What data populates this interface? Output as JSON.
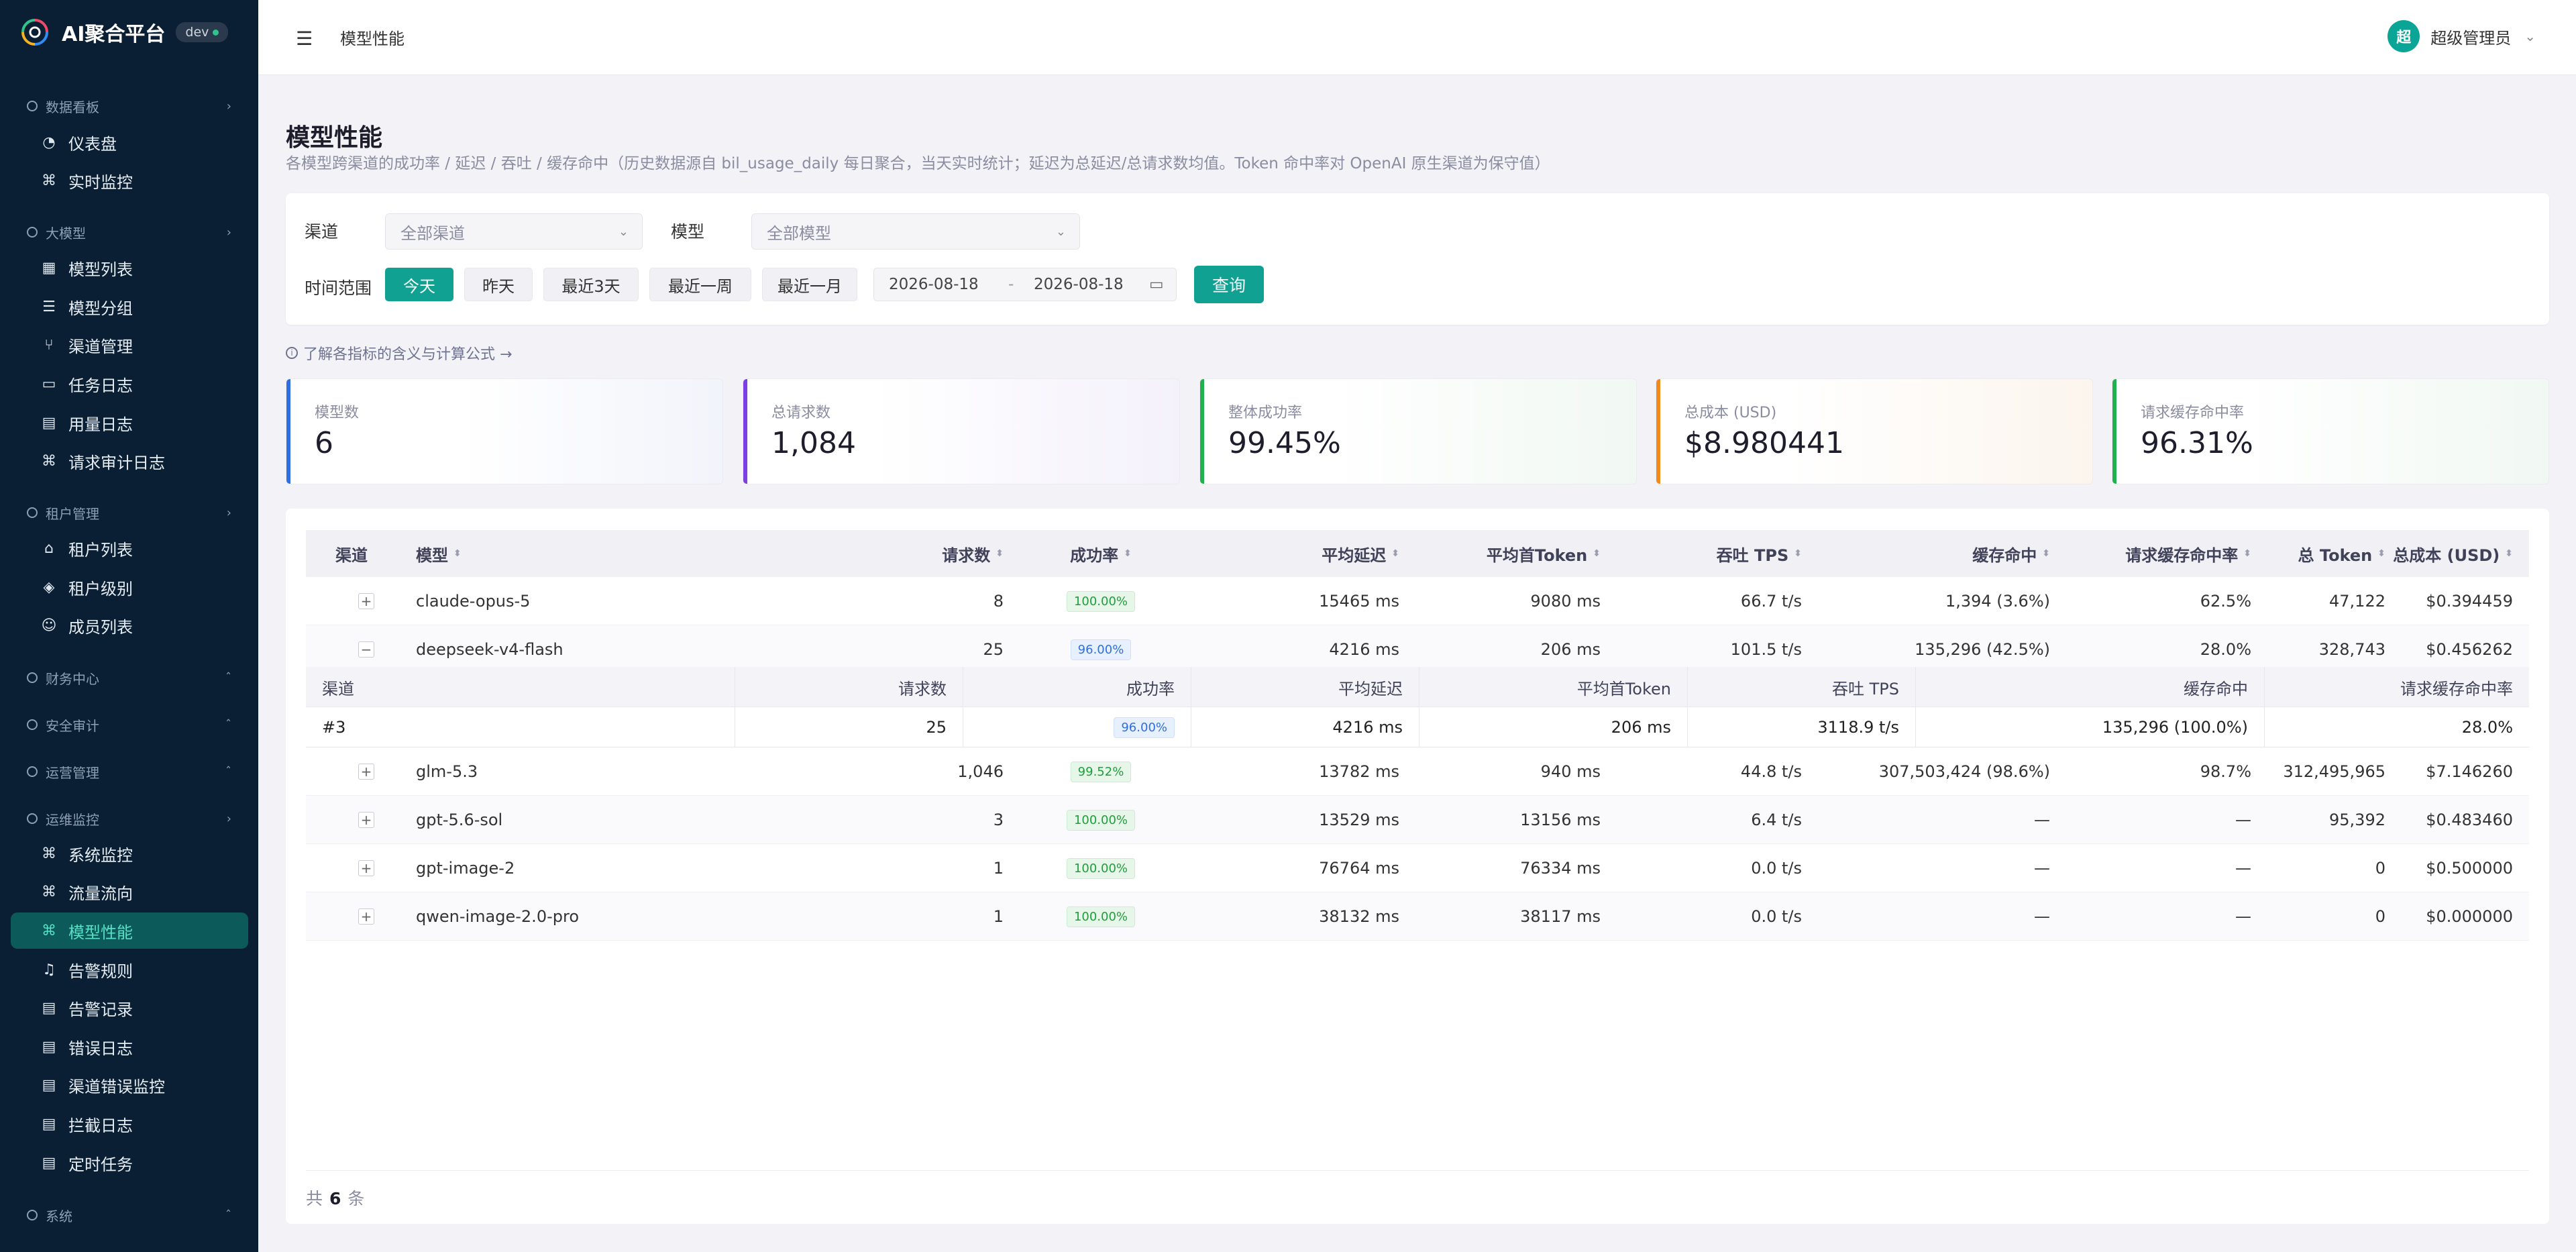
{
  "brand": {
    "name": "AI聚合平台",
    "env": "dev"
  },
  "sidebar": {
    "groups": [
      {
        "title": "数据看板",
        "items": [
          {
            "label": "仪表盘",
            "icon": "dashboard-icon"
          },
          {
            "label": "实时监控",
            "icon": "command-icon"
          }
        ]
      },
      {
        "title": "大模型",
        "items": [
          {
            "label": "模型列表",
            "icon": "grid-icon"
          },
          {
            "label": "模型分组",
            "icon": "list-icon"
          },
          {
            "label": "渠道管理",
            "icon": "branch-icon"
          },
          {
            "label": "任务日志",
            "icon": "calendar-icon"
          },
          {
            "label": "用量日志",
            "icon": "document-icon"
          },
          {
            "label": "请求审计日志",
            "icon": "command-icon"
          }
        ]
      },
      {
        "title": "租户管理",
        "items": [
          {
            "label": "租户列表",
            "icon": "home-icon"
          },
          {
            "label": "租户级别",
            "icon": "layers-icon"
          },
          {
            "label": "成员列表",
            "icon": "user-icon"
          }
        ]
      },
      {
        "title": "财务中心",
        "items": []
      },
      {
        "title": "安全审计",
        "items": []
      },
      {
        "title": "运营管理",
        "items": []
      },
      {
        "title": "运维监控",
        "items": [
          {
            "label": "系统监控",
            "icon": "command-icon"
          },
          {
            "label": "流量流向",
            "icon": "command-icon"
          },
          {
            "label": "模型性能",
            "icon": "command-icon",
            "active": true
          },
          {
            "label": "告警规则",
            "icon": "bell-icon"
          },
          {
            "label": "告警记录",
            "icon": "document-icon"
          },
          {
            "label": "错误日志",
            "icon": "document-icon"
          },
          {
            "label": "渠道错误监控",
            "icon": "document-icon"
          },
          {
            "label": "拦截日志",
            "icon": "document-icon"
          },
          {
            "label": "定时任务",
            "icon": "document-icon"
          }
        ]
      },
      {
        "title": "系统",
        "items": []
      }
    ]
  },
  "topbar": {
    "breadcrumb": "模型性能",
    "user_name": "超级管理员",
    "avatar_text": "超"
  },
  "page": {
    "title": "模型性能",
    "description": "各模型跨渠道的成功率 / 延迟 / 吞吐 / 缓存命中（历史数据源自 bil_usage_daily 每日聚合，当天实时统计；延迟为总延迟/总请求数均值。Token 命中率对 OpenAI 原生渠道为保守值）"
  },
  "filters": {
    "channel_label": "渠道",
    "channel_value": "全部渠道",
    "model_label": "模型",
    "model_value": "全部模型",
    "range_label": "时间范围",
    "ranges": [
      "今天",
      "昨天",
      "最近3天",
      "最近一周",
      "最近一月"
    ],
    "active_range": "今天",
    "date_start": "2026-08-18",
    "date_sep": "-",
    "date_end": "2026-08-18",
    "query_label": "查询"
  },
  "info_link": "了解各指标的含义与计算公式 →",
  "stats": [
    {
      "label": "模型数",
      "value": "6",
      "color": "#2f6fe0"
    },
    {
      "label": "总请求数",
      "value": "1,084",
      "color": "#7b3fe4"
    },
    {
      "label": "整体成功率",
      "value": "99.45%",
      "color": "#1fb14d"
    },
    {
      "label": "总成本 (USD)",
      "value": "$8.980441",
      "color": "#f08a1c"
    },
    {
      "label": "请求缓存命中率",
      "value": "96.31%",
      "color": "#1fb14d"
    }
  ],
  "table": {
    "headers": [
      "渠道",
      "模型",
      "请求数",
      "成功率",
      "平均延迟",
      "平均首Token",
      "吞吐 TPS",
      "缓存命中",
      "请求缓存命中率",
      "总 Token",
      "总成本 (USD)"
    ],
    "rows": [
      {
        "model": "claude-opus-5",
        "requests": "8",
        "success": "100.00%",
        "latency": "15465 ms",
        "first_token": "9080 ms",
        "tps": "66.7 t/s",
        "cache_hit": "1,394 (3.6%)",
        "req_cache": "62.5%",
        "tokens": "47,122",
        "cost": "$0.394459",
        "expand": "+"
      },
      {
        "model": "deepseek-v4-flash",
        "requests": "25",
        "success": "96.00%",
        "latency": "4216 ms",
        "first_token": "206 ms",
        "tps": "101.5 t/s",
        "cache_hit": "135,296 (42.5%)",
        "req_cache": "28.0%",
        "tokens": "328,743",
        "cost": "$0.456262",
        "expand": "−"
      },
      {
        "model": "glm-5.3",
        "requests": "1,046",
        "success": "99.52%",
        "latency": "13782 ms",
        "first_token": "940 ms",
        "tps": "44.8 t/s",
        "cache_hit": "307,503,424 (98.6%)",
        "req_cache": "98.7%",
        "tokens": "312,495,965",
        "cost": "$7.146260",
        "expand": "+"
      },
      {
        "model": "gpt-5.6-sol",
        "requests": "3",
        "success": "100.00%",
        "latency": "13529 ms",
        "first_token": "13156 ms",
        "tps": "6.4 t/s",
        "cache_hit": "—",
        "req_cache": "—",
        "tokens": "95,392",
        "cost": "$0.483460",
        "expand": "+"
      },
      {
        "model": "gpt-image-2",
        "requests": "1",
        "success": "100.00%",
        "latency": "76764 ms",
        "first_token": "76334 ms",
        "tps": "0.0 t/s",
        "cache_hit": "—",
        "req_cache": "—",
        "tokens": "0",
        "cost": "$0.500000",
        "expand": "+"
      },
      {
        "model": "qwen-image-2.0-pro",
        "requests": "1",
        "success": "100.00%",
        "latency": "38132 ms",
        "first_token": "38117 ms",
        "tps": "0.0 t/s",
        "cache_hit": "—",
        "req_cache": "—",
        "tokens": "0",
        "cost": "$0.000000",
        "expand": "+"
      }
    ],
    "sub_headers": [
      "渠道",
      "请求数",
      "成功率",
      "平均延迟",
      "平均首Token",
      "吞吐 TPS",
      "缓存命中",
      "请求缓存命中率"
    ],
    "sub_row": {
      "channel": "#3",
      "requests": "25",
      "success": "96.00%",
      "latency": "4216 ms",
      "first_token": "206 ms",
      "tps": "3118.9 t/s",
      "cache_hit": "135,296 (100.0%)",
      "req_cache": "28.0%"
    }
  },
  "footer": {
    "prefix": "共",
    "count": "6",
    "suffix": "条"
  }
}
